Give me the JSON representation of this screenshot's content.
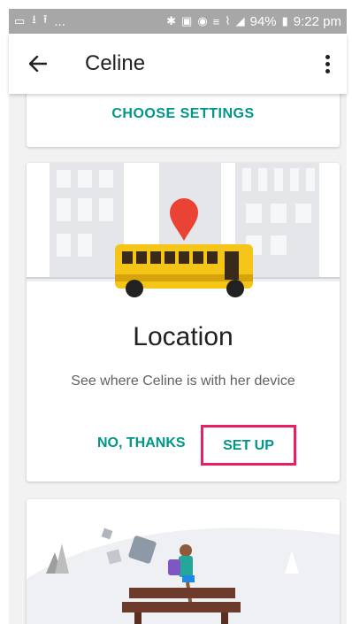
{
  "status_bar": {
    "left_icons": [
      "image-icon",
      "download-icon",
      "upload-icon"
    ],
    "ellipsis": "...",
    "battery": "94%",
    "time": "9:22 pm"
  },
  "app_bar": {
    "title": "Celine"
  },
  "cards": {
    "top": {
      "button_label": "CHOOSE SETTINGS"
    },
    "location": {
      "title": "Location",
      "description": "See where Celine is with her device",
      "no_label": "NO, THANKS",
      "setup_label": "SET UP"
    }
  },
  "colors": {
    "accent": "#009688",
    "highlight": "#e91e63",
    "bus": "#f5c518",
    "pin": "#ea4335"
  }
}
